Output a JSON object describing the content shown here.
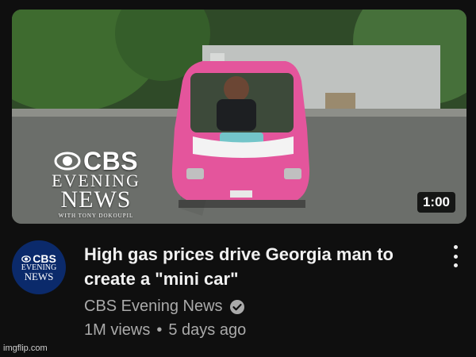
{
  "video": {
    "duration": "1:00",
    "thumbnail_branding": {
      "network": "CBS",
      "line1": "EVENING",
      "line2": "NEWS",
      "subline": "WITH TONY DOKOUPIL"
    },
    "title": "High gas prices drive Georgia man to create a \"mini car\"",
    "channel_name": "CBS Evening News",
    "verified_icon": "verified-check-icon",
    "views": "1M views",
    "separator": "•",
    "age": "5 days ago"
  },
  "channel_avatar": {
    "network": "CBS",
    "line1": "EVENING",
    "line2": "NEWS"
  },
  "more_icon": "more-vertical-icon",
  "watermark": "imgflip.com",
  "colors": {
    "background": "#0f0f0f",
    "title": "#f1f1f1",
    "secondary_text": "#aaaaaa",
    "car_pink": "#e4559c",
    "avatar_blue": "#0b2a6b"
  }
}
